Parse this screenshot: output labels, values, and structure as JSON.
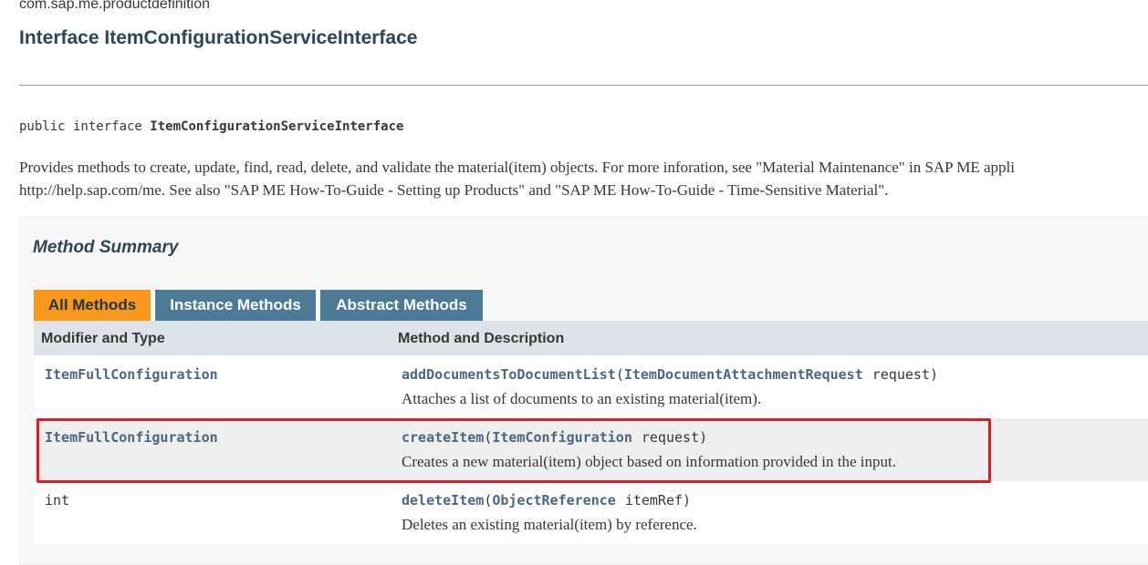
{
  "package": "com.sap.me.productdefinition",
  "title": "Interface ItemConfigurationServiceInterface",
  "signature": {
    "prefix": "public interface ",
    "name": "ItemConfigurationServiceInterface"
  },
  "description": {
    "line1": "Provides methods to create, update, find, read, delete, and validate the material(item) objects. For more inforation, see \"Material Maintenance\" in SAP ME appli",
    "line2": "http://help.sap.com/me. See also \"SAP ME How-To-Guide - Setting up Products\" and \"SAP ME How-To-Guide - Time-Sensitive Material\"."
  },
  "summary": {
    "heading": "Method Summary",
    "tabs": [
      "All Methods",
      "Instance Methods",
      "Abstract Methods"
    ],
    "active_tab": "All Methods",
    "headers": {
      "col1": "Modifier and Type",
      "col2": "Method and Description"
    },
    "rows": [
      {
        "type": "ItemFullConfiguration",
        "method": "addDocumentsToDocumentList",
        "param_type": "ItemDocumentAttachmentRequest",
        "param_name": "request",
        "desc": "Attaches a list of documents to an existing material(item)."
      },
      {
        "type": "ItemFullConfiguration",
        "method": "createItem",
        "param_type": "ItemConfiguration",
        "param_name": "request",
        "desc": "Creates a new material(item) object based on information provided in the input."
      },
      {
        "type": "int",
        "method": "deleteItem",
        "param_type": "ObjectReference",
        "param_name": "itemRef",
        "desc": "Deletes an existing material(item) by reference."
      }
    ]
  },
  "colors": {
    "active_tab": "#f8981d",
    "inactive_tab": "#4d7a97",
    "link": "#4a6782",
    "highlight_box": "#e01b24"
  }
}
